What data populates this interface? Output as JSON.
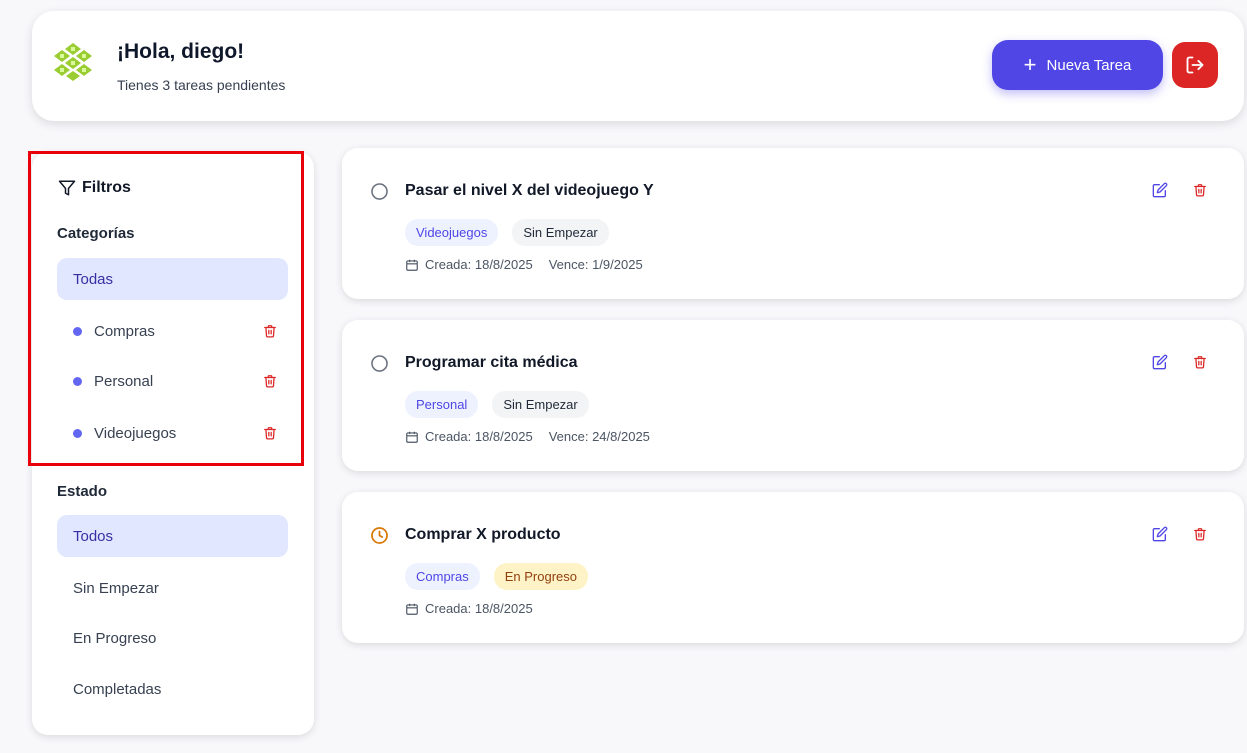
{
  "header": {
    "greeting": "¡Hola, diego!",
    "subtitle": "Tienes 3 tareas pendientes",
    "new_task_label": "Nueva Tarea",
    "avatar_icon": "avatar-pattern-icon",
    "logout_icon": "logout-icon"
  },
  "sidebar": {
    "title": "Filtros",
    "categories_label": "Categorías",
    "categories": [
      {
        "label": "Todas",
        "active": true
      },
      {
        "label": "Compras",
        "color": "#6366f1"
      },
      {
        "label": "Personal",
        "color": "#6366f1"
      },
      {
        "label": "Videojuegos",
        "color": "#6366f1"
      }
    ],
    "status_label": "Estado",
    "statuses": [
      {
        "label": "Todos",
        "active": true
      },
      {
        "label": "Sin Empezar"
      },
      {
        "label": "En Progreso"
      },
      {
        "label": "Completadas"
      }
    ]
  },
  "tasks": [
    {
      "title": "Pasar el nivel X del videojuego Y",
      "category": "Videojuegos",
      "status": "Sin Empezar",
      "created": "Creada: 18/8/2025",
      "due": "Vence: 1/9/2025",
      "status_icon": "circle-icon"
    },
    {
      "title": "Programar cita médica",
      "category": "Personal",
      "status": "Sin Empezar",
      "created": "Creada: 18/8/2025",
      "due": "Vence: 24/8/2025",
      "status_icon": "circle-icon"
    },
    {
      "title": "Comprar X producto",
      "category": "Compras",
      "status": "En Progreso",
      "created": "Creada: 18/8/2025",
      "due": "",
      "status_icon": "clock-icon"
    }
  ],
  "colors": {
    "accent": "#4f46e5",
    "danger": "#dc2626",
    "highlight_box": "#e8000b",
    "in_progress": "#d97706"
  }
}
